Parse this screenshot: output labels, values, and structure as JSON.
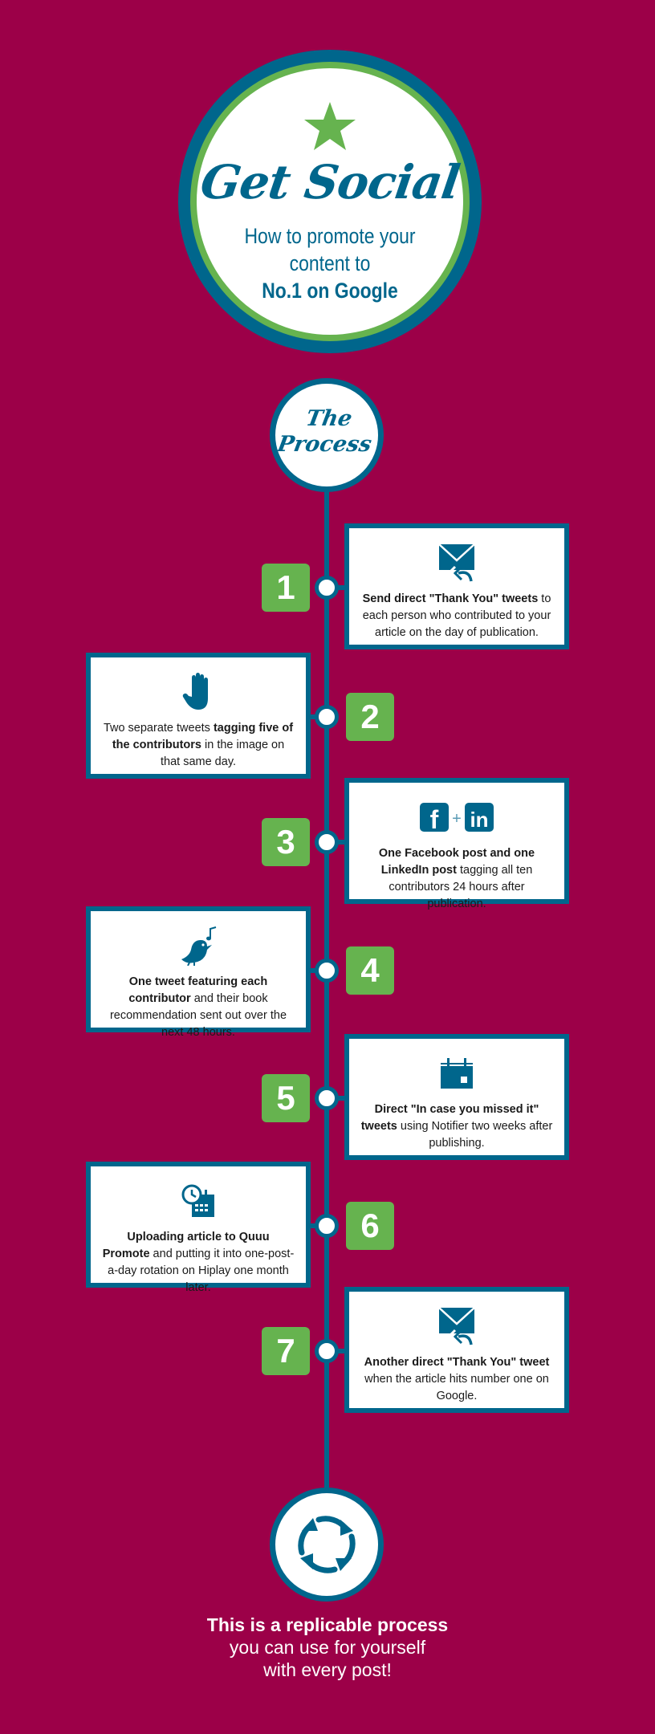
{
  "colors": {
    "background": "#9c0048",
    "brand_blue": "#00668c",
    "brand_green": "#66b34f",
    "card_bg": "#ffffff"
  },
  "hero": {
    "icon": "star-icon",
    "title": "Get Social",
    "subtitle_line1": "How to promote your",
    "subtitle_line2": "content to",
    "subtitle_line3": "No.1 on Google"
  },
  "process": {
    "label_line1": "The",
    "label_line2": "Process"
  },
  "steps": [
    {
      "number": "1",
      "side": "right",
      "icon": "envelope-reply-icon",
      "bold": "Send direct \"Thank You\" tweets",
      "rest": " to each person who contributed to your article on the day of publication."
    },
    {
      "number": "2",
      "side": "left",
      "icon": "hand-icon",
      "pre": "Two separate tweets ",
      "bold": "tagging five of the contributors",
      "rest": " in the image on that same day."
    },
    {
      "number": "3",
      "side": "right",
      "icon": "facebook-plus-linkedin-icon",
      "bold": "One Facebook post and one LinkedIn post",
      "rest": " tagging all ten contributors 24 hours after publication."
    },
    {
      "number": "4",
      "side": "left",
      "icon": "singing-bird-icon",
      "bold": "One tweet featuring each contributor",
      "rest": " and their book recommendation sent out over the next 48 hours."
    },
    {
      "number": "5",
      "side": "right",
      "icon": "calendar-icon",
      "bold": "Direct \"In case you missed it\" tweets",
      "rest": " using Notifier two weeks after publishing."
    },
    {
      "number": "6",
      "side": "left",
      "icon": "clock-calendar-icon",
      "bold": "Uploading article to Quuu Promote",
      "rest": " and putting it into one-post-a-day rotation on Hiplay one month later."
    },
    {
      "number": "7",
      "side": "right",
      "icon": "envelope-reply-icon",
      "bold": "Another direct \"Thank You\" tweet",
      "rest": " when the article hits number one on Google."
    }
  ],
  "closing": {
    "icon": "cycle-arrows-icon",
    "line1": "This is a replicable process",
    "line2": "you can use for yourself",
    "line3": "with every post!"
  }
}
